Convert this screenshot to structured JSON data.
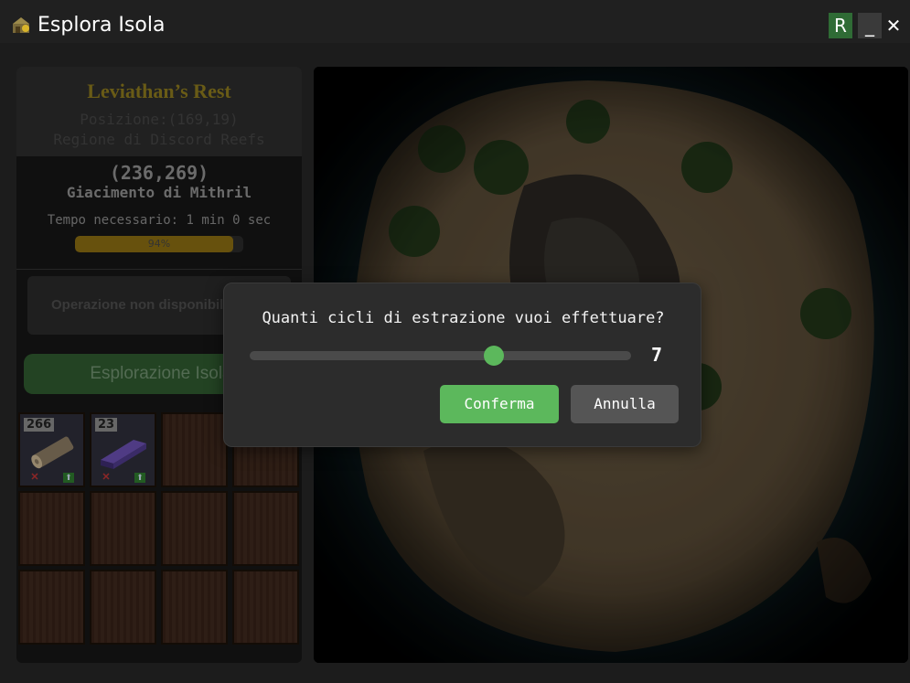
{
  "window": {
    "title": "Esplora Isola",
    "r_label": "R",
    "minimize_label": "_",
    "close_label": "✕"
  },
  "location": {
    "name": "Leviathan’s Rest",
    "position": "Posizione:(169,19)",
    "region": "Regione di Discord Reefs"
  },
  "target": {
    "coords": "(236,269)",
    "name": "Giacimento di Mithril",
    "time_required": "Tempo necessario: 1 min 0 sec",
    "progress_percent": 94,
    "progress_label": "94%"
  },
  "actions": {
    "unavailable_label": "Operazione non disponibile",
    "explore_label": "Esplorazione Isola"
  },
  "inventory": [
    {
      "qty": "266",
      "item": "log-icon"
    },
    {
      "qty": "23",
      "item": "metal-beam-icon"
    },
    {},
    {},
    {},
    {},
    {},
    {},
    {},
    {},
    {},
    {}
  ],
  "dialog": {
    "question": "Quanti cicli di estrazione vuoi effettuare?",
    "slider_value": "7",
    "slider_fraction": 0.64,
    "confirm_label": "Conferma",
    "cancel_label": "Annulla"
  },
  "colors": {
    "accent_green": "#5cb85c",
    "progress_gold": "#8a6d12"
  }
}
